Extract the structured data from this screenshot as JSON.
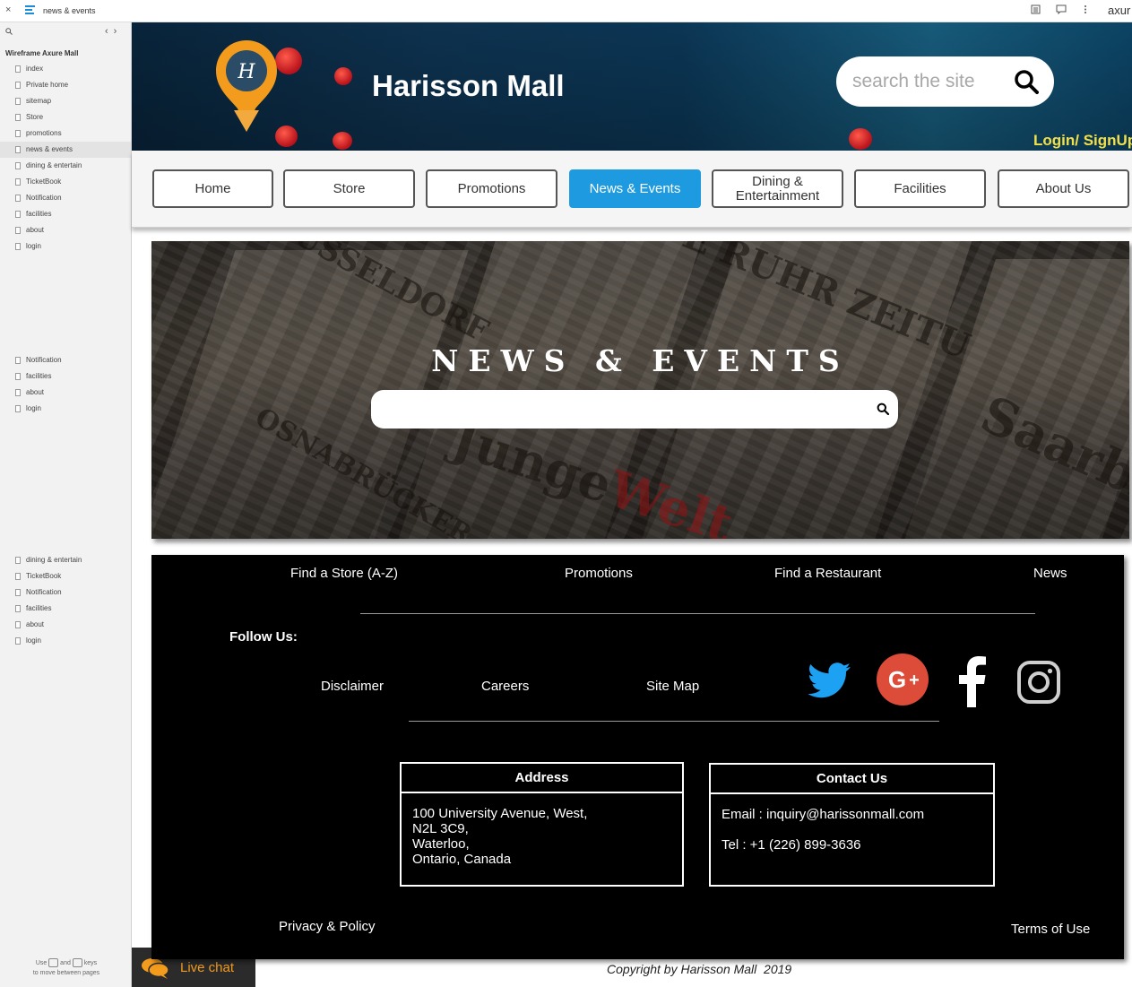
{
  "topbar": {
    "close": "×",
    "page_name": "news & events",
    "brand": "axur"
  },
  "sidebar": {
    "project": "Wireframe Axure Mall",
    "groups": [
      [
        "index",
        "Private home",
        "sitemap",
        "Store",
        "promotions",
        "news & events",
        "dining & entertain",
        "TicketBook",
        "Notification",
        "facilities",
        "about",
        "login"
      ],
      [
        "Notification",
        "facilities",
        "about",
        "login"
      ],
      [
        "dining & entertain",
        "TicketBook",
        "Notification",
        "facilities",
        "about",
        "login"
      ]
    ],
    "active_item": "news & events",
    "hint_line1": "Use",
    "hint_and": "and",
    "hint_keys": "keys",
    "hint_line2": "to move between pages"
  },
  "livechat": {
    "label": "Live chat"
  },
  "header": {
    "title": "Harisson Mall",
    "search_placeholder": "search the site",
    "login": "Login/ SignUp"
  },
  "nav": {
    "items": [
      "Home",
      "Store",
      "Promotions",
      "News & Events",
      "Dining & Entertainment",
      "Facilities",
      "About Us"
    ],
    "active": "News & Events"
  },
  "hero": {
    "title": "NEWS & EVENTS",
    "search_placeholder": ""
  },
  "footer": {
    "top_links": [
      "Find a Store (A-Z)",
      "Promotions",
      "Find a Restaurant",
      "News"
    ],
    "follow_us": "Follow Us:",
    "mid_links": [
      "Disclaimer",
      "Careers",
      "Site Map"
    ],
    "social": [
      "twitter-icon",
      "google-plus-icon",
      "facebook-icon",
      "instagram-icon"
    ],
    "address": {
      "heading": "Address",
      "lines": [
        "100 University Avenue, West,",
        "N2L 3C9,",
        "Waterloo,",
        "Ontario, Canada"
      ]
    },
    "contact": {
      "heading": "Contact Us",
      "email": "Email : inquiry@harissonmall.com",
      "tel": "Tel : +1 (226) 899-3636"
    },
    "privacy": "Privacy & Policy",
    "terms": "Terms of Use"
  },
  "copyright": "Copyright by Harisson Mall  2019",
  "colors": {
    "accent": "#1e9be0",
    "login": "#f2e04a",
    "logo": "#f29b1d",
    "google": "#dd4b39",
    "twitter": "#1da1f2"
  }
}
